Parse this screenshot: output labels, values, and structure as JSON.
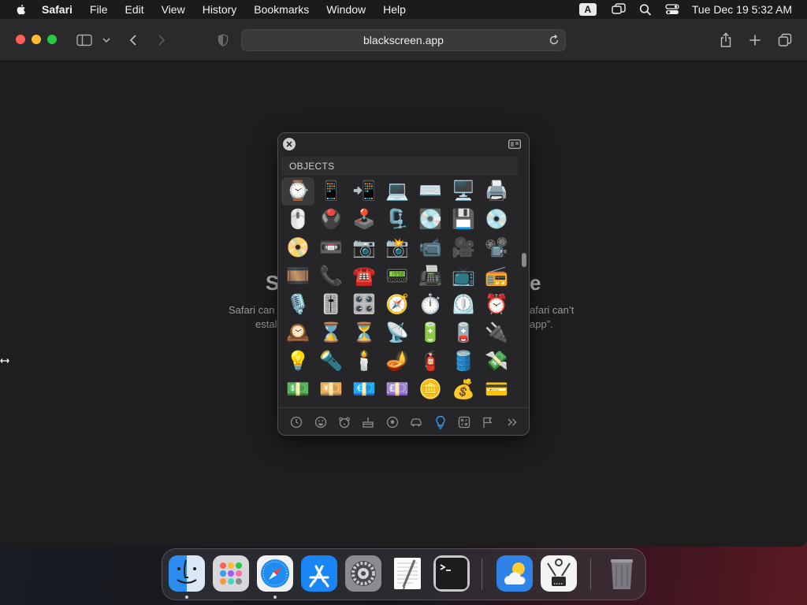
{
  "menubar": {
    "app": "Safari",
    "items": [
      "File",
      "Edit",
      "View",
      "History",
      "Bookmarks",
      "Window",
      "Help"
    ],
    "input_source": "A",
    "clock": "Tue Dec 19  5:32 AM"
  },
  "browser": {
    "url": "blackscreen.app"
  },
  "error_page": {
    "title_left": "S",
    "title_right": "e",
    "line1_left": "Safari can",
    "line1_right": "afari can’t",
    "line2_left": "estal",
    "line2_right": "app”."
  },
  "emoji_picker": {
    "section": "OBJECTS",
    "emojis": [
      "⌚",
      "📱",
      "📲",
      "💻",
      "⌨️",
      "🖥️",
      "🖨️",
      "🖱️",
      "🖲️",
      "🕹️",
      "🗜️",
      "💽",
      "💾",
      "💿",
      "📀",
      "📼",
      "📷",
      "📸",
      "📹",
      "🎥",
      "📽️",
      "🎞️",
      "📞",
      "☎️",
      "📟",
      "📠",
      "📺",
      "📻",
      "🎙️",
      "🎚️",
      "🎛️",
      "🧭",
      "⏱️",
      "⏲️",
      "⏰",
      "🕰️",
      "⌛",
      "⏳",
      "📡",
      "🔋",
      "🪫",
      "🔌",
      "💡",
      "🔦",
      "🕯️",
      "🪔",
      "🧯",
      "🛢️",
      "💸",
      "💵",
      "💴",
      "💶",
      "💷",
      "🪙",
      "💰",
      "💳"
    ],
    "categories": [
      "frequently-used",
      "smileys",
      "animals",
      "food",
      "activity",
      "travel",
      "objects",
      "symbols",
      "flags",
      "more"
    ],
    "active_category": "objects"
  },
  "dock": {
    "apps": [
      "Finder",
      "Launchpad",
      "Safari",
      "App Store",
      "System Settings",
      "TextEdit",
      "Terminal",
      "Weather",
      "Digital Color Meter",
      "Trash"
    ]
  }
}
